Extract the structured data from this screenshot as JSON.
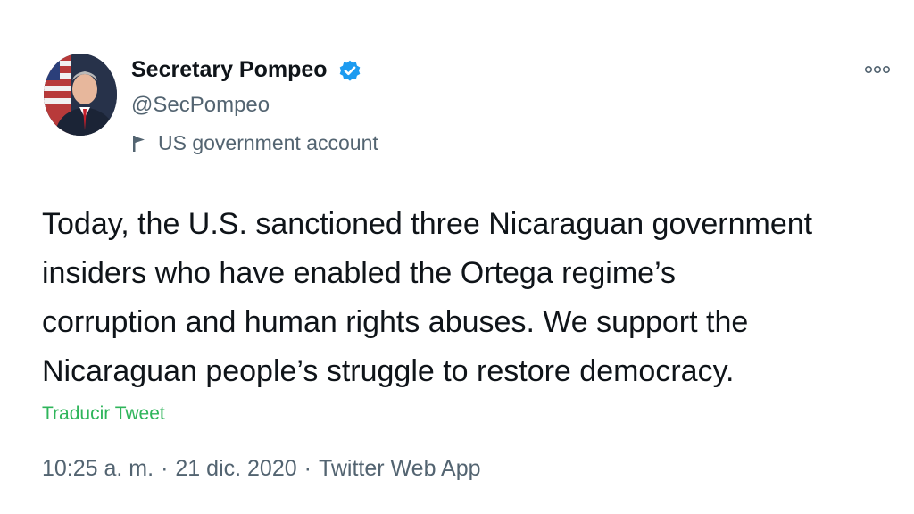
{
  "author": {
    "display_name": "Secretary Pompeo",
    "handle": "@SecPompeo",
    "account_label": "US government account",
    "avatar_icon": "profile-photo",
    "verified_icon": "verified-badge-icon",
    "verified_color": "#1d9bf0"
  },
  "tweet": {
    "lines": [
      "Today, the U.S. sanctioned three Nicaraguan government",
      "insiders who have enabled the Ortega regime’s",
      "corruption and human rights abuses. We support the",
      "Nicaraguan people’s struggle to restore democracy."
    ],
    "translate_label": "Traducir Tweet",
    "translate_color": "#2fb55b"
  },
  "meta": {
    "time": "10:25 a. m.",
    "date": "21 dic. 2020",
    "source": "Twitter Web App",
    "separator": "·"
  },
  "icons": {
    "more": "more-options-icon",
    "flag": "flag-icon"
  }
}
